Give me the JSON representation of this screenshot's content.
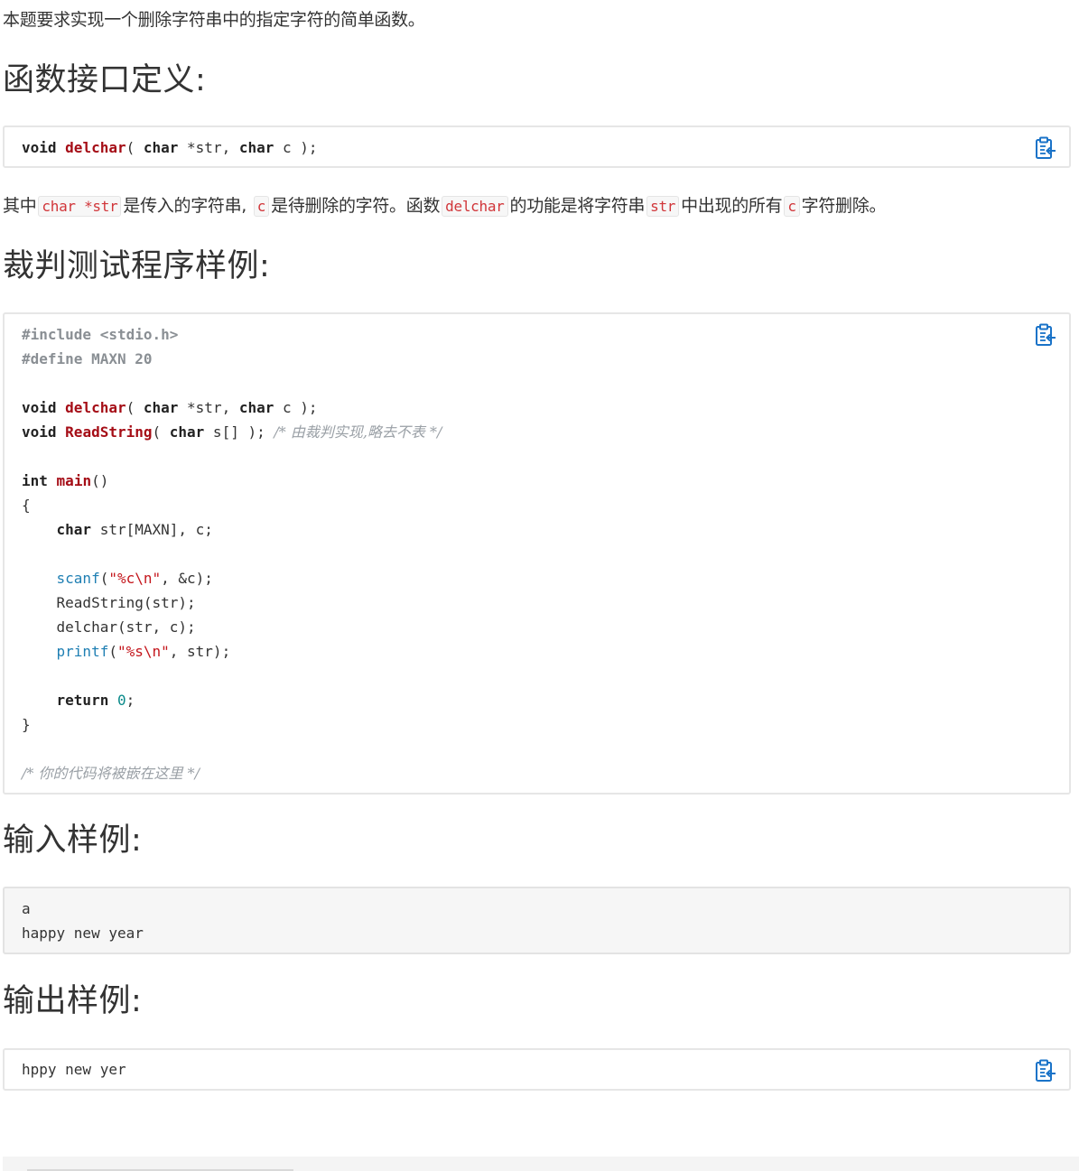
{
  "intro": "本题要求实现一个删除字符串中的指定字符的简单函数。",
  "section_interface": {
    "title": "函数接口定义:",
    "code": {
      "t1": "void",
      "fn": "delchar",
      "t2": "( ",
      "t3": "char",
      "t4": " *str, ",
      "t5": "char",
      "t6": " c );"
    }
  },
  "description": {
    "p1": "其中",
    "c1": "char *str",
    "p2": "是传入的字符串,",
    "c2": "c",
    "p3": "是待删除的字符。函数",
    "c3": "delchar",
    "p4": "的功能是将字符串",
    "c4": "str",
    "p5": "中出现的所有",
    "c5": "c",
    "p6": "字符删除。"
  },
  "section_judge": {
    "title": "裁判测试程序样例:",
    "code": {
      "inc": "#include <stdio.h>",
      "def": "#define",
      "def_rest": " MAXN 20",
      "l4_kw1": "void",
      "l4_fn": "delchar",
      "l4_a": "( ",
      "l4_kw2": "char",
      "l4_b": " *str, ",
      "l4_kw3": "char",
      "l4_c": " c );",
      "l5_kw1": "void",
      "l5_fn": "ReadString",
      "l5_a": "( ",
      "l5_kw2": "char",
      "l5_b": " s[] ); ",
      "l5_cm": "/* 由裁判实现,略去不表 */",
      "l7_kw": "int",
      "l7_fn": "main",
      "l7_rest": "()",
      "l8": "{",
      "l9_kw": "char",
      "l9_rest": " str[MAXN], c;",
      "l11_bi": "scanf",
      "l11_a": "(",
      "l11_str": "\"%c\\n\"",
      "l11_b": ", &c);",
      "l12": "ReadString(str);",
      "l13": "delchar(str, c);",
      "l14_bi": "printf",
      "l14_a": "(",
      "l14_str": "\"%s\\n\"",
      "l14_b": ", str);",
      "l16_kw": "return",
      "l16_num": "0",
      "l16_rest": ";",
      "l17": "}",
      "l19_cm": "/* 你的代码将被嵌在这里 */"
    }
  },
  "section_input": {
    "title": "输入样例:",
    "line1": "a",
    "line2": "happy new year"
  },
  "section_output": {
    "title": "输出样例:",
    "line1": "hppy new yer"
  },
  "icons": {
    "copy": "clipboard-copy-icon",
    "accent": "#1a73c8"
  }
}
